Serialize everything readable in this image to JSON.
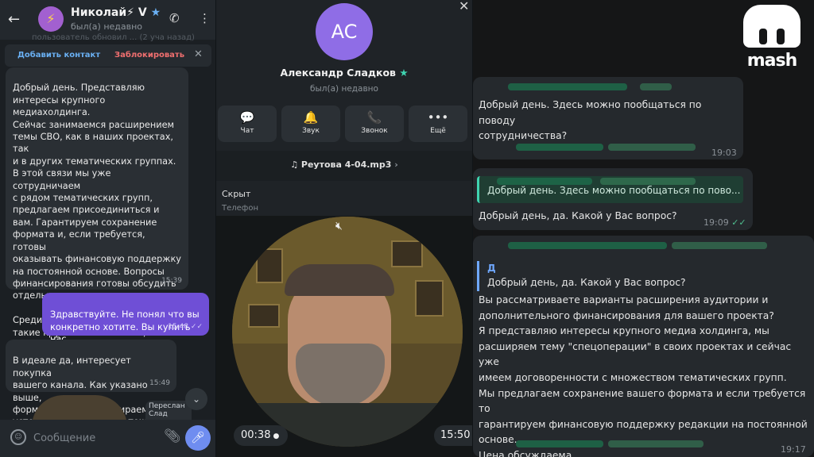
{
  "left": {
    "contact_name": "Николай⚡ V",
    "contact_star": "★",
    "contact_status": "был(а) недавно",
    "avatar_glyph": "⚡",
    "ghost_text": "пользователь обновил ... (2 уча назад)",
    "add_contact": "Добавить контакт",
    "block": "Заблокировать",
    "messages": [
      {
        "text": "Добрый день. Представляю\nинтересы крупного медиахолдинга.\nСейчас занимаемся расширением\nтемы СВО, как в наших проектах, так\nи в других тематических группах.\nВ этой связи мы уже сотрудничаем\nс рядом тематических групп,\nпредлагаем присоединиться и\nвам. Гарантируем сохранение\nформата и, если требуется, готовы\nоказывать финансовую поддержку\nна постоянной основе. Вопросы\nфинансирования готовы обсудить\nотдельно.\n\nСреди наших партнёров уже есть\nтакие крупные и именитые, как\nСергей Колясников и Александр\nСладков.",
        "time": "15:39"
      },
      {
        "text": "Здравствуйте. Не понял что вы\nконкретно хотите. Вы купить нас\nпредлагаете?",
        "time": "15:48"
      },
      {
        "text": "В идеале да, интересует покупка\nвашего канала. Как указано выше,\nформат менять не собираемся,\nустоявшуюся команду - тоже.",
        "time": "15:49"
      }
    ],
    "forwarded_label": "Переслан",
    "forwarded_from": "Слад",
    "input_placeholder": "Сообщение"
  },
  "middle": {
    "avatar_initials": "AC",
    "name": "Александр Сладков",
    "name_star": "★",
    "status": "был(а) недавно",
    "actions": [
      {
        "label": "Чат",
        "icon": "💬"
      },
      {
        "label": "Звук",
        "icon": "🔔"
      },
      {
        "label": "Звонок",
        "icon": "📞"
      },
      {
        "label": "Ещё",
        "icon": "•••"
      }
    ],
    "audio_file": "♫ Реутова 4-04.mp3",
    "audio_chevron": "›",
    "phone_value": "Скрыт",
    "phone_label": "Телефон",
    "video_duration": "00:38",
    "video_clock": "15:50"
  },
  "right": {
    "logo": "mash",
    "messages": [
      {
        "text": "Добрый день. Здесь можно пообщаться по поводу\nсотрудничества?",
        "time": "19:03"
      },
      {
        "quote": "Добрый день. Здесь можно пообщаться по пово...",
        "text": "Добрый день, да. Какой у Вас вопрос?",
        "time": "19:09",
        "checks": "✓✓"
      },
      {
        "quote_name": "Д",
        "quote": "Добрый день, да. Какой у Вас вопрос?",
        "text": "Вы рассматриваете варианты расширения аудитории и\nдополнительного финансирования для вашего проекта?\nЯ представляю интересы крупного медиа холдинга, мы\nрасширяем тему \"спецоперации\" в своих проектах и сейчас уже\nимеем договоренности с множеством тематических групп.\nМы предлагаем сохранение вашего формата и если требуется то\nгарантируем финансовую поддержку редакции на постоянной\nоснове.\nЦена обсуждаема",
        "time": "19:17"
      }
    ]
  }
}
